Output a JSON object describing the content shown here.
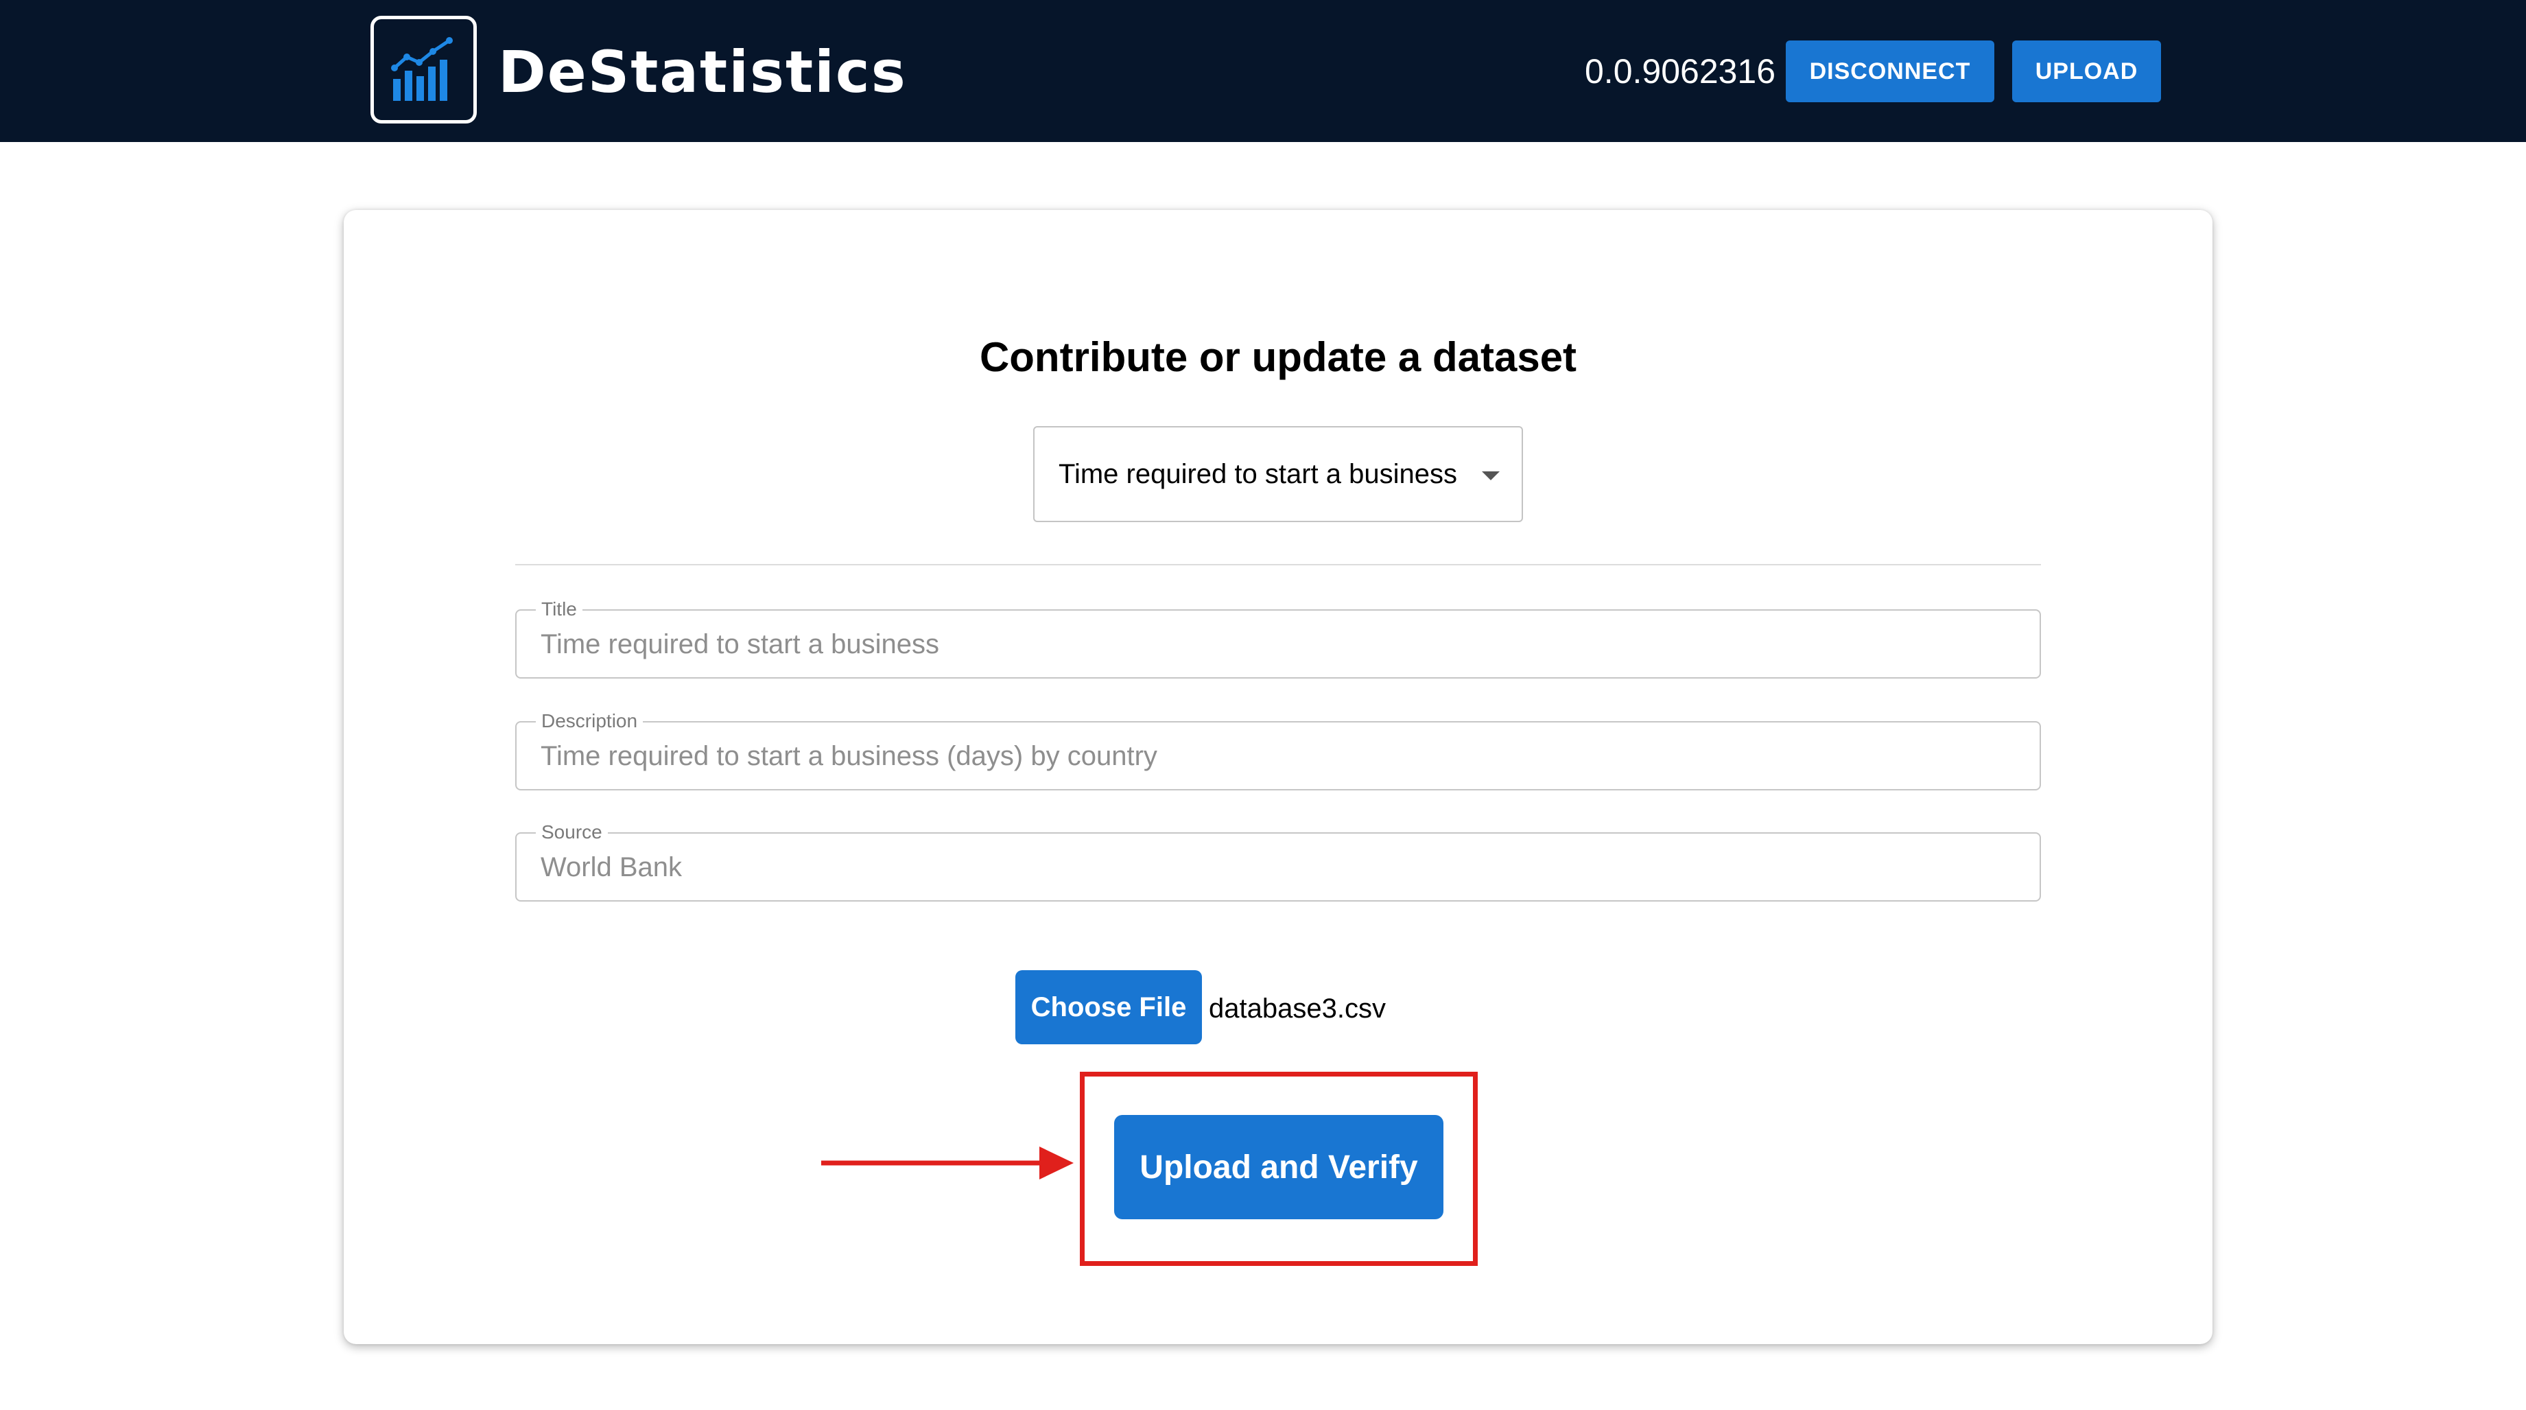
{
  "header": {
    "brand": "DeStatistics",
    "account_id": "0.0.9062316",
    "disconnect_label": "DISCONNECT",
    "upload_label": "UPLOAD",
    "logo_icon": "bar-chart-trend-icon"
  },
  "form": {
    "heading": "Contribute or update a dataset",
    "dataset_select": {
      "selected": "Time required to start a business"
    },
    "fields": {
      "title": {
        "label": "Title",
        "value": "Time required to start a business"
      },
      "description": {
        "label": "Description",
        "value": "Time required to start a business (days) by country"
      },
      "source": {
        "label": "Source",
        "value": "World Bank"
      }
    },
    "file": {
      "button_label": "Choose File",
      "file_name": "database3.csv"
    },
    "submit_label": "Upload and Verify"
  },
  "colors": {
    "navbar": "#06152a",
    "primary": "#1976d2",
    "highlight": "#e0201c"
  }
}
